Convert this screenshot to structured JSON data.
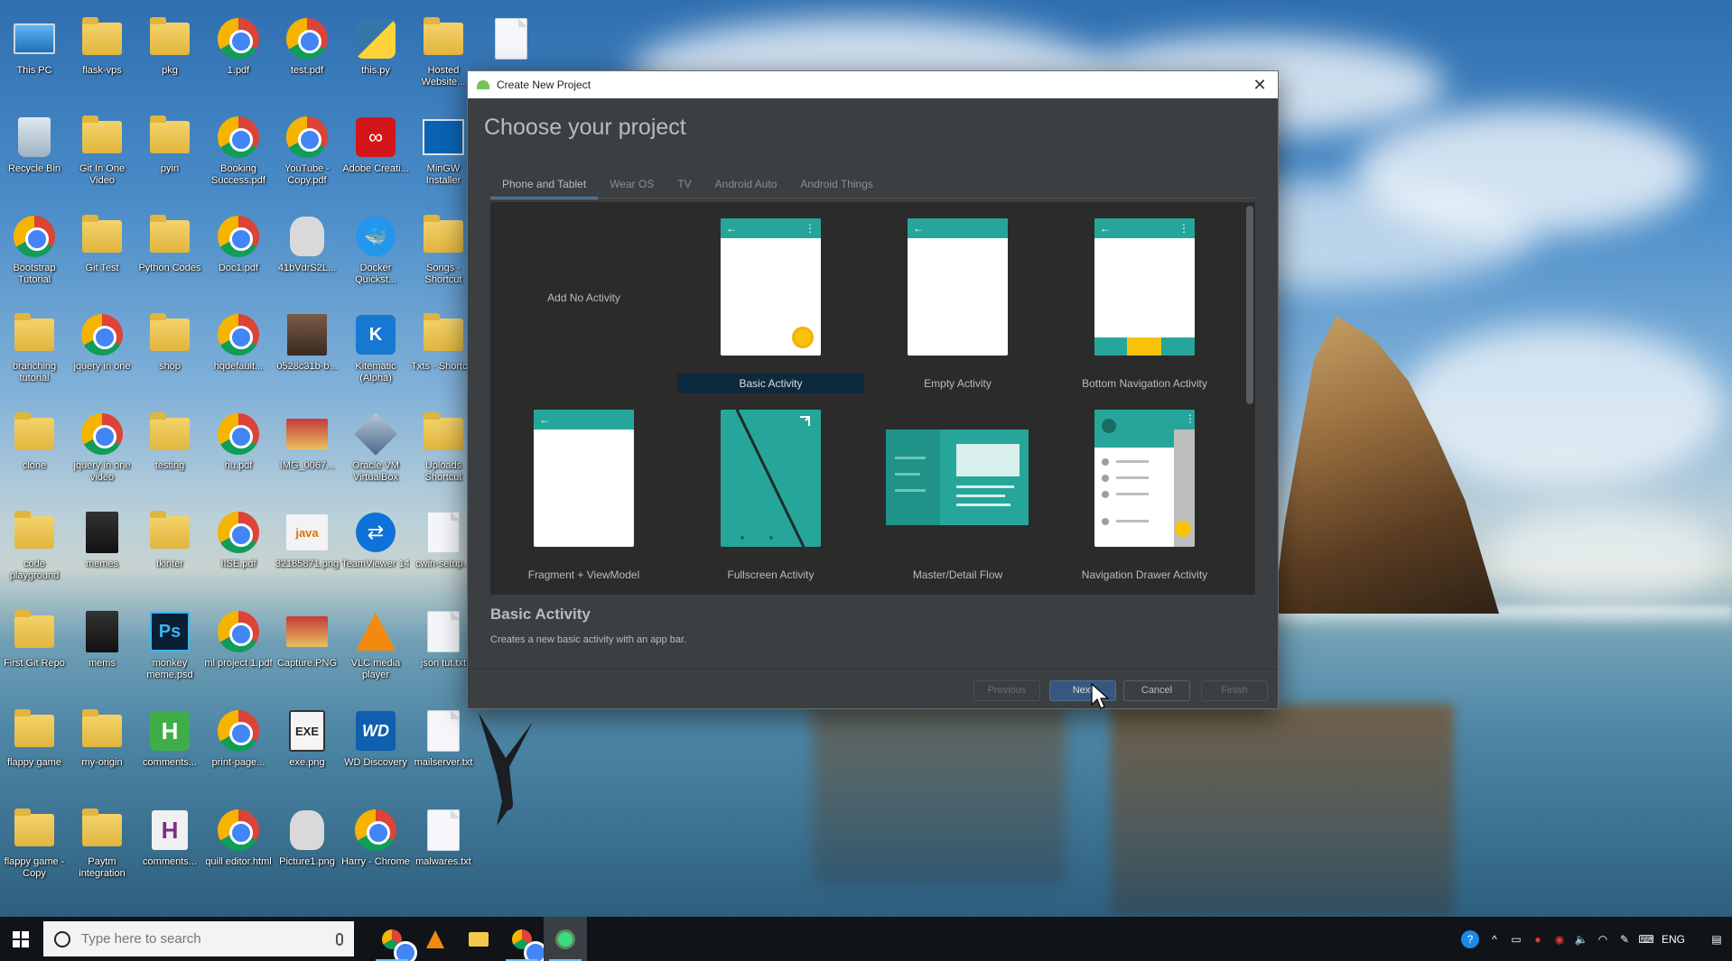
{
  "desktop": {
    "icons": [
      {
        "label": "This PC",
        "type": "pc"
      },
      {
        "label": "flask-vps",
        "type": "folder"
      },
      {
        "label": "pkg",
        "type": "folder"
      },
      {
        "label": "1.pdf",
        "type": "chrome"
      },
      {
        "label": "test.pdf",
        "type": "chrome"
      },
      {
        "label": "this.py",
        "type": "py"
      },
      {
        "label": "Hosted Website...",
        "type": "folder"
      },
      {
        "label": "",
        "type": "file"
      },
      {
        "label": "Recycle Bin",
        "type": "bin"
      },
      {
        "label": "Git In One Video",
        "type": "folder"
      },
      {
        "label": "pyin",
        "type": "folder"
      },
      {
        "label": "Booking Success.pdf",
        "type": "chrome"
      },
      {
        "label": "YouTube - Copy.pdf",
        "type": "chrome"
      },
      {
        "label": "Adobe Creati...",
        "type": "adobe"
      },
      {
        "label": "MinGW Installer",
        "type": "win"
      },
      {
        "label": "",
        "type": "none"
      },
      {
        "label": "Bootstrap Tutorial",
        "type": "chrome"
      },
      {
        "label": "Git Test",
        "type": "folder"
      },
      {
        "label": "Python Codes",
        "type": "folder"
      },
      {
        "label": "Doc1.pdf",
        "type": "chrome"
      },
      {
        "label": "41bVdrS2L...",
        "type": "robot"
      },
      {
        "label": "Docker Quickst...",
        "type": "whale"
      },
      {
        "label": "Songs - Shortcut",
        "type": "folder"
      },
      {
        "label": "",
        "type": "none"
      },
      {
        "label": "branching tutorial",
        "type": "folder"
      },
      {
        "label": "jquery in one",
        "type": "chrome"
      },
      {
        "label": "shop",
        "type": "folder"
      },
      {
        "label": "hqdefault...",
        "type": "chrome"
      },
      {
        "label": "0528c31b-b...",
        "type": "photo"
      },
      {
        "label": "Kitematic (Alpha)",
        "type": "kitematic"
      },
      {
        "label": "Txts - Shortcut",
        "type": "folder"
      },
      {
        "label": "",
        "type": "none"
      },
      {
        "label": "clone",
        "type": "folder"
      },
      {
        "label": "jquery in one video",
        "type": "chrome"
      },
      {
        "label": "testing",
        "type": "folder"
      },
      {
        "label": "hu.pdf",
        "type": "chrome"
      },
      {
        "label": "IMG_0067...",
        "type": "img"
      },
      {
        "label": "Oracle VM VirtualBox",
        "type": "box"
      },
      {
        "label": "Uploads Shortcut",
        "type": "folder"
      },
      {
        "label": "",
        "type": "none"
      },
      {
        "label": "code playground",
        "type": "folder"
      },
      {
        "label": "memes",
        "type": "dark"
      },
      {
        "label": "tkinter",
        "type": "folder"
      },
      {
        "label": "IISE.pdf",
        "type": "chrome"
      },
      {
        "label": "32185871.png",
        "type": "java"
      },
      {
        "label": "TeamViewer 14",
        "type": "tv"
      },
      {
        "label": "cwin-setup...",
        "type": "file"
      },
      {
        "label": "",
        "type": "none"
      },
      {
        "label": "First Git Repo",
        "type": "folder"
      },
      {
        "label": "mems",
        "type": "dark"
      },
      {
        "label": "monkey meme.psd",
        "type": "ps"
      },
      {
        "label": "ml project 1.pdf",
        "type": "chrome"
      },
      {
        "label": "Capture.PNG",
        "type": "img"
      },
      {
        "label": "VLC media player",
        "type": "vlc"
      },
      {
        "label": "json tut.txt",
        "type": "file"
      },
      {
        "label": "",
        "type": "none"
      },
      {
        "label": "flappy game",
        "type": "folder"
      },
      {
        "label": "my-origin",
        "type": "folder"
      },
      {
        "label": "comments...",
        "type": "h"
      },
      {
        "label": "print-page...",
        "type": "chrome"
      },
      {
        "label": "exe.png",
        "type": "exe"
      },
      {
        "label": "WD Discovery",
        "type": "wd"
      },
      {
        "label": "mailserver.txt",
        "type": "file"
      },
      {
        "label": "",
        "type": "none"
      },
      {
        "label": "flappy game - Copy",
        "type": "folder"
      },
      {
        "label": "Paytm integration",
        "type": "folder"
      },
      {
        "label": "comments...",
        "type": "h2"
      },
      {
        "label": "quill editor.html",
        "type": "chrome"
      },
      {
        "label": "Picture1.png",
        "type": "robot"
      },
      {
        "label": "Harry - Chrome",
        "type": "chrome"
      },
      {
        "label": "malwares.txt",
        "type": "file"
      },
      {
        "label": "",
        "type": "none"
      }
    ]
  },
  "dialog": {
    "title": "Create New Project",
    "heading": "Choose your project",
    "tabs": [
      "Phone and Tablet",
      "Wear OS",
      "TV",
      "Android Auto",
      "Android Things"
    ],
    "active_tab": "Phone and Tablet",
    "templates": [
      {
        "label": "Add No Activity"
      },
      {
        "label": "Basic Activity"
      },
      {
        "label": "Empty Activity"
      },
      {
        "label": "Bottom Navigation Activity"
      },
      {
        "label": "Fragment + ViewModel"
      },
      {
        "label": "Fullscreen Activity"
      },
      {
        "label": "Master/Detail Flow"
      },
      {
        "label": "Navigation Drawer Activity"
      }
    ],
    "selected_template": "Basic Activity",
    "description_title": "Basic Activity",
    "description_text": "Creates a new basic activity with an app bar.",
    "buttons": {
      "previous": "Previous",
      "next": "Next",
      "cancel": "Cancel",
      "finish": "Finish"
    },
    "accent_color": "#26a69a",
    "fab_color": "#f9c20a"
  },
  "taskbar": {
    "search_placeholder": "Type here to search",
    "apps": [
      "chrome-icon",
      "vlc-icon",
      "file-explorer-icon",
      "chrome-alt-icon",
      "android-studio-icon"
    ],
    "tray_language": "ENG"
  }
}
